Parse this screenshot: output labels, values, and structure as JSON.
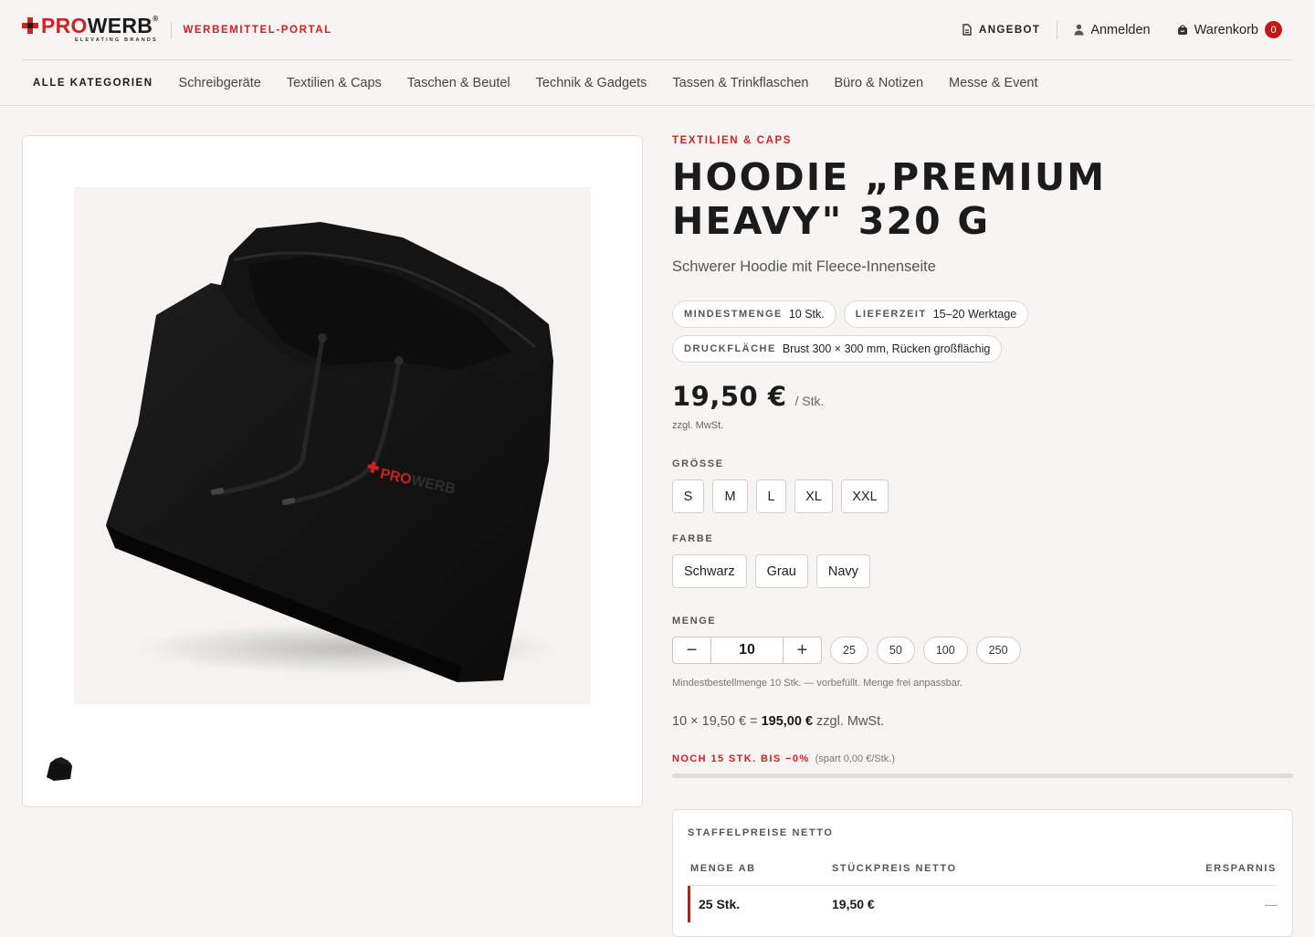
{
  "header": {
    "logo": {
      "pro": "PRO",
      "werb": "WERB",
      "reg": "®",
      "tagline": "ELEVATING BRANDS"
    },
    "portal_label": "WERBEMITTEL-PORTAL",
    "angebot_label": "ANGEBOT",
    "login_label": "Anmelden",
    "cart_label": "Warenkorb",
    "cart_count": "0"
  },
  "nav": {
    "all_label": "ALLE KATEGORIEN",
    "items": [
      "Schreibgeräte",
      "Textilien & Caps",
      "Taschen & Beutel",
      "Technik & Gadgets",
      "Tassen & Trinkflaschen",
      "Büro & Notizen",
      "Messe & Event"
    ]
  },
  "gallery": {
    "image_alt": "hoodie-image",
    "thumb_count": 1
  },
  "product": {
    "category": "TEXTILIEN & CAPS",
    "title": "Hoodie „Premium Heavy\" 320 g",
    "subtitle": "Schwerer Hoodie mit Fleece-Innenseite",
    "chips": [
      {
        "k": "MINDESTMENGE",
        "v": "10 Stk."
      },
      {
        "k": "LIEFERZEIT",
        "v": "15–20 Werktage"
      },
      {
        "k": "DRUCKFLÄCHE",
        "v": "Brust 300 × 300 mm, Rücken großflächig"
      }
    ],
    "price": "19,50 €",
    "price_unit": "/ Stk.",
    "tax_note": "zzgl. MwSt.",
    "size_label": "GRÖSSE",
    "sizes": [
      "S",
      "M",
      "L",
      "XL",
      "XXL"
    ],
    "color_label": "FARBE",
    "colors": [
      "Schwarz",
      "Grau",
      "Navy"
    ],
    "qty_label": "MENGE",
    "qty_value": "10",
    "qty_minus": "−",
    "qty_plus": "+",
    "qty_presets": [
      "25",
      "50",
      "100",
      "250"
    ],
    "qty_hint": "Mindestbestellmenge 10 Stk. — vorbefüllt. Menge frei anpassbar.",
    "calc_prefix": "10 × 19,50 € = ",
    "calc_total": "195,00 €",
    "calc_suffix": " zzgl. MwSt.",
    "nudge_red": "NOCH 15 STK. BIS −0%",
    "nudge_small": "(spart 0,00 €/Stk.)",
    "progress": 0
  },
  "tiers": {
    "title": "STAFFELPREISE NETTO",
    "headers": [
      "MENGE AB",
      "STÜCKPREIS NETTO",
      "ERSPARNIS"
    ],
    "rows": [
      {
        "qty": "25 Stk.",
        "price": "19,50 €",
        "saving": "—"
      }
    ]
  },
  "colors": {
    "accent": "#d42020",
    "badge": "#c41818",
    "background": "#f6f5f3"
  }
}
